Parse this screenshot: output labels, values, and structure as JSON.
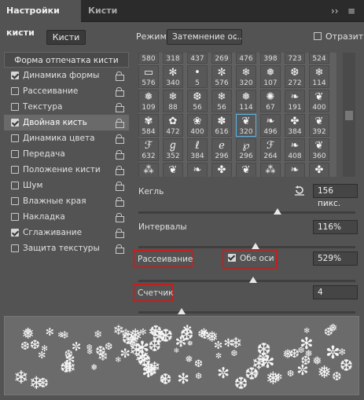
{
  "tabs": {
    "active": "Настройки кисти",
    "inactive": "Кисти",
    "collapse": "››",
    "menu": "≡"
  },
  "brushes_button": "Кисти",
  "left_panel": {
    "header": "Форма отпечатка кисти",
    "items": [
      {
        "label": "Динамика формы",
        "checked": true,
        "locked": true
      },
      {
        "label": "Рассеивание",
        "checked": false,
        "locked": true
      },
      {
        "label": "Текстура",
        "checked": false,
        "locked": true
      },
      {
        "label": "Двойная кисть",
        "checked": true,
        "locked": true,
        "selected": true
      },
      {
        "label": "Динамика цвета",
        "checked": false,
        "locked": true
      },
      {
        "label": "Передача",
        "checked": false,
        "locked": true
      },
      {
        "label": "Положение кисти",
        "checked": false,
        "locked": true
      },
      {
        "label": "Шум",
        "checked": false,
        "locked": true
      },
      {
        "label": "Влажные края",
        "checked": false,
        "locked": true
      },
      {
        "label": "Накладка",
        "checked": false,
        "locked": true
      },
      {
        "label": "Сглаживание",
        "checked": true,
        "locked": true
      },
      {
        "label": "Защита текстуры",
        "checked": false,
        "locked": true
      }
    ]
  },
  "mode": {
    "label": "Режим:",
    "value": "Затемнение  ос...",
    "chevron": "⌄"
  },
  "flip": {
    "label": "Отразить",
    "checked": false
  },
  "brush_grid": {
    "selected_index": 28,
    "rows": [
      [
        "580",
        "318",
        "437",
        "269",
        "476",
        "398",
        "723",
        "524"
      ],
      [
        "576",
        "340",
        "5",
        "576",
        "320",
        "107",
        "272",
        "114"
      ],
      [
        "109",
        "88",
        "56",
        "56",
        "114",
        "67",
        "191",
        "400"
      ],
      [
        "584",
        "472",
        "400",
        "616",
        "320",
        "496",
        "384",
        "392"
      ],
      [
        "632",
        "352",
        "384",
        "296",
        "296",
        "264",
        "408",
        "360"
      ],
      [
        "",
        "",
        "",
        "",
        "",
        "",
        "",
        ""
      ]
    ],
    "glyphs": [
      [
        "",
        "",
        "",
        "",
        "",
        "",
        "",
        ""
      ],
      [
        "▭",
        "✻",
        "•",
        "✼",
        "❄",
        "❅",
        "❆",
        "❄"
      ],
      [
        "❅",
        "❄",
        "❆",
        "❄",
        "❅",
        "✺",
        "❧",
        "❦"
      ],
      [
        "✾",
        "✿",
        "❀",
        "✽",
        "❦",
        "❧",
        "✤",
        "❦"
      ],
      [
        "ℱ",
        "ℊ",
        "ℓ",
        "ℯ",
        "℘",
        "ℱ",
        "❧",
        "❦"
      ],
      [
        "⁂",
        "❦",
        "❧",
        "✤",
        "❦",
        "⁂",
        "❧",
        "✤"
      ]
    ]
  },
  "size": {
    "label": "Кегль",
    "value": "156 пикс.",
    "level_percent": 64
  },
  "spacing": {
    "label": "Интервалы",
    "value": "116%",
    "level_percent": 54
  },
  "scatter": {
    "label": "Рассеивание",
    "both_axes_label": "Обе оси",
    "both_axes_checked": true,
    "value": "529%",
    "level_percent": 53
  },
  "count": {
    "label": "Счетчик",
    "value": "4",
    "level_percent": 20
  },
  "colors": {
    "highlight": "#c41f1f",
    "selection": "#5ab5e8",
    "panel": "#535353"
  }
}
